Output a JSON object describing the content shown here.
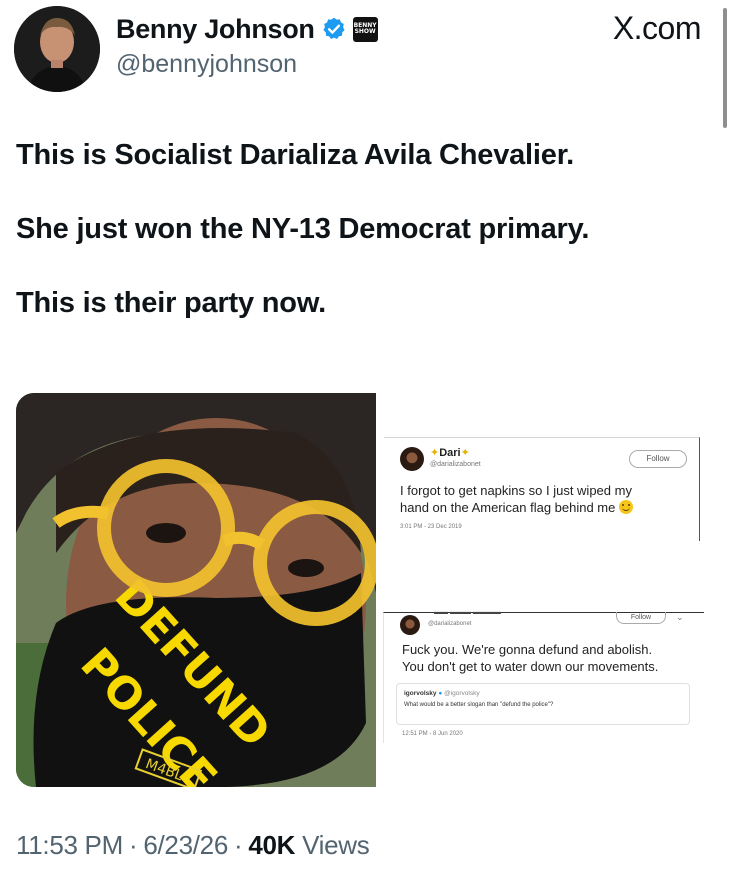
{
  "author": {
    "display_name": "Benny Johnson",
    "handle": "@bennyjohnson",
    "verified_icon": "verified-check-icon",
    "org_badge_text": [
      "BENNY",
      "SHOW"
    ]
  },
  "site_label": "X.com",
  "tweet": {
    "paragraphs": [
      "This is Socialist Darializa Avila Chevalier.",
      "She just won the NY-13 Democrat primary.",
      "This is their party now."
    ]
  },
  "photo": {
    "mask_line1": "DEFUND",
    "mask_line2": "POLICE",
    "mask_tag": "M4BL"
  },
  "embedded_tweet_1": {
    "name": "Dari",
    "handle": "@darializabonet",
    "follow_label": "Follow",
    "body_line1": "I forgot to get napkins so I just wiped my",
    "body_line2": "hand on the American flag behind me",
    "timestamp": "3:01 PM - 23 Dec 2019"
  },
  "embedded_tweet_2": {
    "handle": "@darializabonet",
    "follow_label": "Follow",
    "body_line1": "Fuck you. We're gonna defund and abolish.",
    "body_line2": "You don't get to water down our movements.",
    "quoted_name": "igorvolsky",
    "quoted_handle": "@igorvolsky",
    "quoted_text": "What would be a better slogan than \"defund the police\"?",
    "timestamp": "12:51 PM - 8 Jun 2020"
  },
  "footer": {
    "time": "11:53 PM",
    "separator": "·",
    "date": "6/23/26",
    "views_count": "40K",
    "views_label": "Views"
  },
  "colors": {
    "text_primary": "#0f1419",
    "text_secondary": "#536471",
    "verified_blue": "#1d9bf0",
    "mask_yellow": "#f7d900"
  }
}
